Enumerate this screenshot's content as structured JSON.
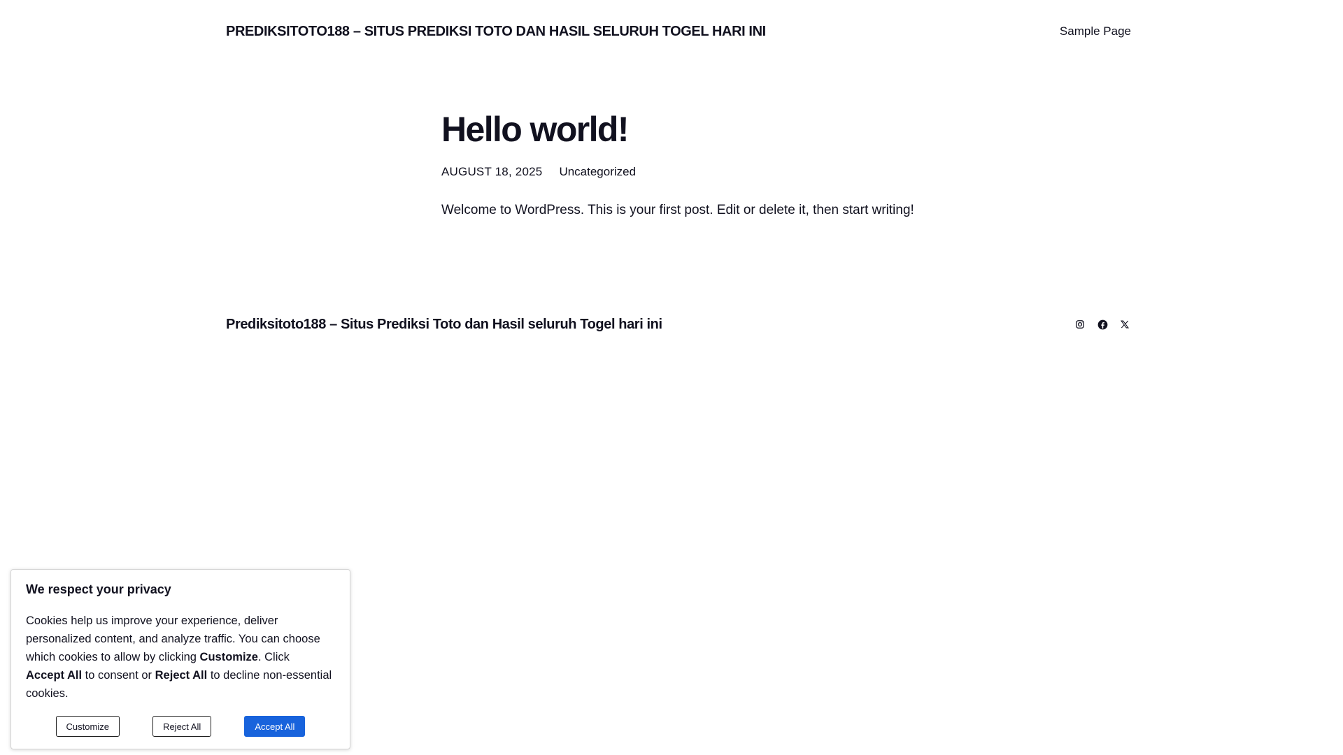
{
  "header": {
    "site_title": "PREDIKSITOTO188 – SITUS PREDIKSI TOTO DAN HASIL SELURUH TOGEL HARI INI",
    "nav": [
      {
        "label": "Sample Page"
      }
    ]
  },
  "post": {
    "title": "Hello world!",
    "date": "AUGUST 18, 2025",
    "category": "Uncategorized",
    "content": "Welcome to WordPress. This is your first post. Edit or delete it, then start writing!"
  },
  "footer": {
    "site_title": "Prediksitoto188 – Situs Prediksi Toto dan Hasil seluruh Togel hari ini",
    "social": [
      {
        "icon": "instagram-icon"
      },
      {
        "icon": "facebook-icon"
      },
      {
        "icon": "x-icon"
      }
    ]
  },
  "cookie": {
    "title": "We respect your privacy",
    "text_1": "Cookies help us improve your experience, deliver personalized content, and analyze traffic. You can choose which cookies to allow by clicking ",
    "customize_bold": "Customize",
    "text_2": ". Click ",
    "accept_bold": "Accept All",
    "text_3": " to consent or ",
    "reject_bold": "Reject All",
    "text_4": " to decline non-essential cookies.",
    "customize_label": "Customize",
    "reject_label": "Reject All",
    "accept_label": "Accept All",
    "accent_color": "#1863dc"
  }
}
